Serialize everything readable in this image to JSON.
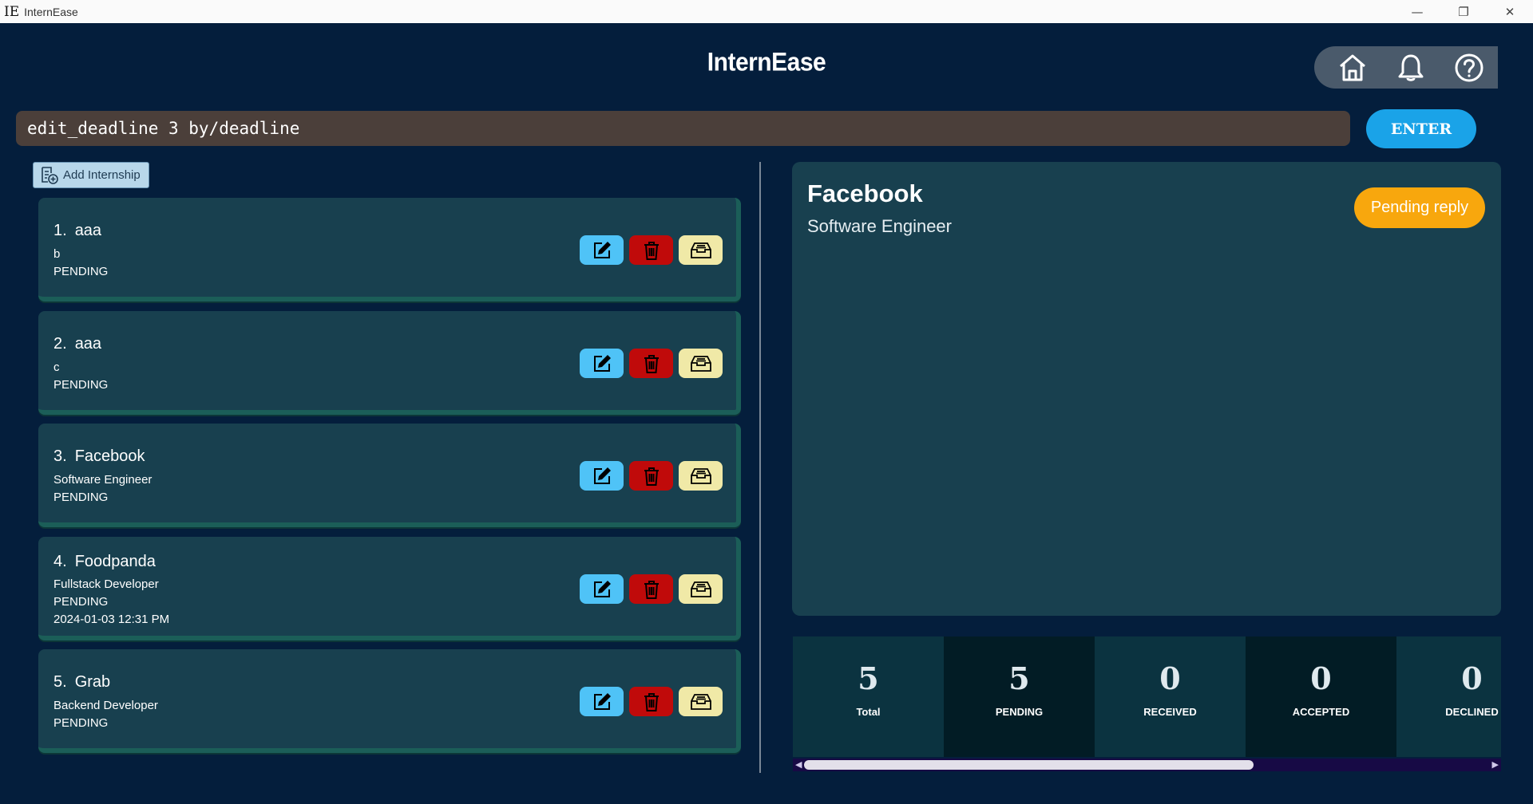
{
  "window": {
    "icon_text": "IE",
    "title": "InternEase",
    "controls": {
      "minimize": "—",
      "maximize": "❐",
      "close": "✕"
    }
  },
  "header": {
    "title": "InternEase",
    "nav": [
      "home-icon",
      "bell-icon",
      "help-icon"
    ]
  },
  "command": {
    "value": "edit_deadline 3 by/deadline",
    "enter_label": "ENTER"
  },
  "add_button": {
    "label": "Add Internship"
  },
  "internships": [
    {
      "index": "1.",
      "company": "aaa",
      "role": "b",
      "status": "PENDING",
      "deadline": ""
    },
    {
      "index": "2.",
      "company": "aaa",
      "role": "c",
      "status": "PENDING",
      "deadline": ""
    },
    {
      "index": "3.",
      "company": "Facebook",
      "role": "Software Engineer",
      "status": "PENDING",
      "deadline": ""
    },
    {
      "index": "4.",
      "company": "Foodpanda",
      "role": "Fullstack Developer",
      "status": "PENDING",
      "deadline": "2024-01-03 12:31 PM"
    },
    {
      "index": "5.",
      "company": "Grab",
      "role": "Backend Developer",
      "status": "PENDING",
      "deadline": ""
    }
  ],
  "detail": {
    "company": "Facebook",
    "role": "Software Engineer",
    "status_badge": "Pending reply"
  },
  "stats": [
    {
      "value": "5",
      "label": "Total"
    },
    {
      "value": "5",
      "label": "PENDING"
    },
    {
      "value": "0",
      "label": "RECEIVED"
    },
    {
      "value": "0",
      "label": "ACCEPTED"
    },
    {
      "value": "0",
      "label": "DECLINED"
    }
  ],
  "stats_scroll": {
    "position": 0.0
  },
  "colors": {
    "background": "#041e3c",
    "card": "#18404f",
    "edit": "#4fc3f7",
    "delete": "#c00a0a",
    "archive": "#f0e9a7",
    "enter": "#1aa3e8",
    "badge": "#f8a70d",
    "command_bg": "#4b3f3a"
  }
}
